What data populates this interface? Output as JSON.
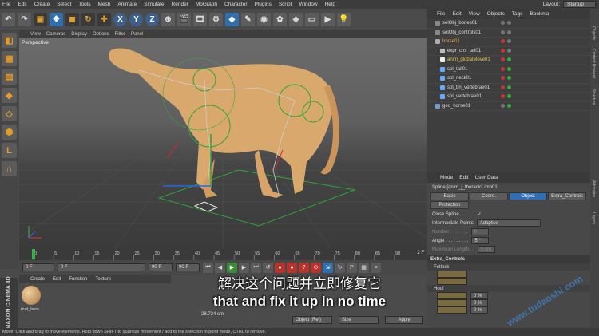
{
  "menubar": {
    "items": [
      "File",
      "Edit",
      "Create",
      "Select",
      "Tools",
      "Mesh",
      "Animate",
      "Simulate",
      "Render",
      "MoGraph",
      "Character",
      "Plugins",
      "Script",
      "Window",
      "Help"
    ],
    "layout_label": "Layout:",
    "layout_value": "Startup"
  },
  "toolbar": {
    "axis_x": "X",
    "axis_y": "Y",
    "axis_z": "Z"
  },
  "viewport": {
    "menu": [
      "View",
      "Cameras",
      "Display",
      "Options",
      "Filter",
      "Panel"
    ],
    "label": "Perspective"
  },
  "timeline": {
    "ticks": [
      "0",
      "5",
      "10",
      "15",
      "20",
      "25",
      "30",
      "35",
      "40",
      "45",
      "50",
      "55",
      "60",
      "65",
      "70",
      "75",
      "80",
      "85",
      "90"
    ],
    "end_frame": "2 F"
  },
  "playbar": {
    "start": "0 F",
    "current": "0 F",
    "end": "90 F",
    "max": "90 F"
  },
  "materials": {
    "menu": [
      "Create",
      "Edit",
      "Function",
      "Texture"
    ],
    "material_name": "mat_hors"
  },
  "coords": {
    "value": "28.724 cm",
    "mode": "Object (Rel)",
    "size": "Size",
    "apply": "Apply"
  },
  "status": "Move: Click and drag to move elements. Hold down SHIFT to quantize movement / add to the selection in point mode, CTRL to remove.",
  "objects": {
    "menu": [
      "File",
      "Edit",
      "View",
      "Objects",
      "Tags",
      "Bookma"
    ],
    "rows": [
      {
        "name": "selObj_bones01"
      },
      {
        "name": "selObj_controls01"
      },
      {
        "name": "horse01"
      },
      {
        "name": "expr_cns_tail01"
      },
      {
        "name": "anim_globalMove01"
      },
      {
        "name": "spl_tail01"
      },
      {
        "name": "spl_neck01"
      },
      {
        "name": "spl_bn_vertebrae01"
      },
      {
        "name": "spl_vertebrae01"
      },
      {
        "name": "geo_horse01"
      }
    ]
  },
  "attributes": {
    "menu": [
      "Mode",
      "Edit",
      "User Data"
    ],
    "title": "Spline [anim_j_thoracicLimb01]",
    "tabs": [
      "Basic",
      "Coord.",
      "Object",
      "Extra_Controls",
      "Protection"
    ],
    "active_tab": "Object",
    "close_spline": "Close Spline . . . . . .",
    "intermediate_label": "Intermediate Points",
    "intermediate_value": "Adaptive",
    "number_label": "Number . . . . . . .",
    "number_value": "8",
    "angle_label": "Angle . . . . . . . . .",
    "angle_value": "5 °",
    "maxlen_label": "Maximum Length . .",
    "maxlen_value": "5 cm",
    "section": "Extra_Controls",
    "sub1": "Fetlock",
    "sub2": "Hoof",
    "pct1": "0 %",
    "pct2": "0 %",
    "pct3": "0 %"
  },
  "sidetabs": [
    "Objects",
    "Content Browser",
    "Structure",
    "Attributes",
    "Layers"
  ],
  "subtitle": {
    "cn": "解决这个问题并立即修复它",
    "en": "that and fix it up in no time"
  },
  "watermark": "www.tudaoshi.com",
  "brand": "MAXON CINEMA 4D"
}
